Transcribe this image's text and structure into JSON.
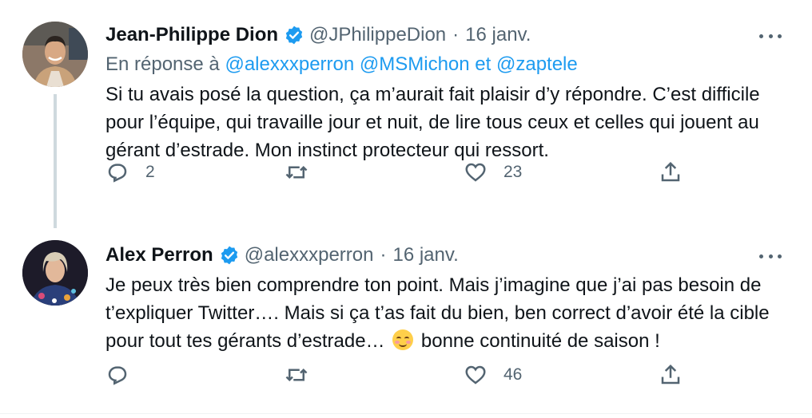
{
  "tweets": [
    {
      "name": "Jean-Philippe Dion",
      "handle": "@JPhilippeDion",
      "separator": "·",
      "date": "16 janv.",
      "reply_prefix": "En réponse à",
      "reply_mentions": [
        "@alexxxperron",
        "@MSMichon",
        "et",
        "@zaptele"
      ],
      "text": "Si tu avais posé la question, ça m’aurait fait plaisir d’y répondre. C’est difficile pour l’équipe, qui travaille jour et nuit, de lire tous ceux et celles qui jouent au gérant d’estrade. Mon instinct protecteur qui ressort.",
      "replies": "2",
      "retweets": "",
      "likes": "23"
    },
    {
      "name": "Alex Perron",
      "handle": "@alexxxperron",
      "separator": "·",
      "date": "16 janv.",
      "text_before_emoji": "Je peux très bien comprendre ton point. Mais j’imagine que j’ai pas besoin de t’expliquer Twitter…. Mais si ça t’as fait du bien, ben correct d’avoir été la cible pour tout tes gérants d’estrade…",
      "text_after_emoji": "bonne continuité de saison !",
      "emoji": "smiling-face-with-smiling-eyes",
      "replies": "",
      "retweets": "",
      "likes": "46"
    }
  ],
  "colors": {
    "text": "#0f1419",
    "secondary": "#536471",
    "link": "#1d9bf0",
    "verified": "#1d9bf0",
    "thread_line": "#cfd9de"
  },
  "icons": [
    "reply-icon",
    "retweet-icon",
    "like-icon",
    "share-icon",
    "verified-badge-icon",
    "more-icon"
  ]
}
